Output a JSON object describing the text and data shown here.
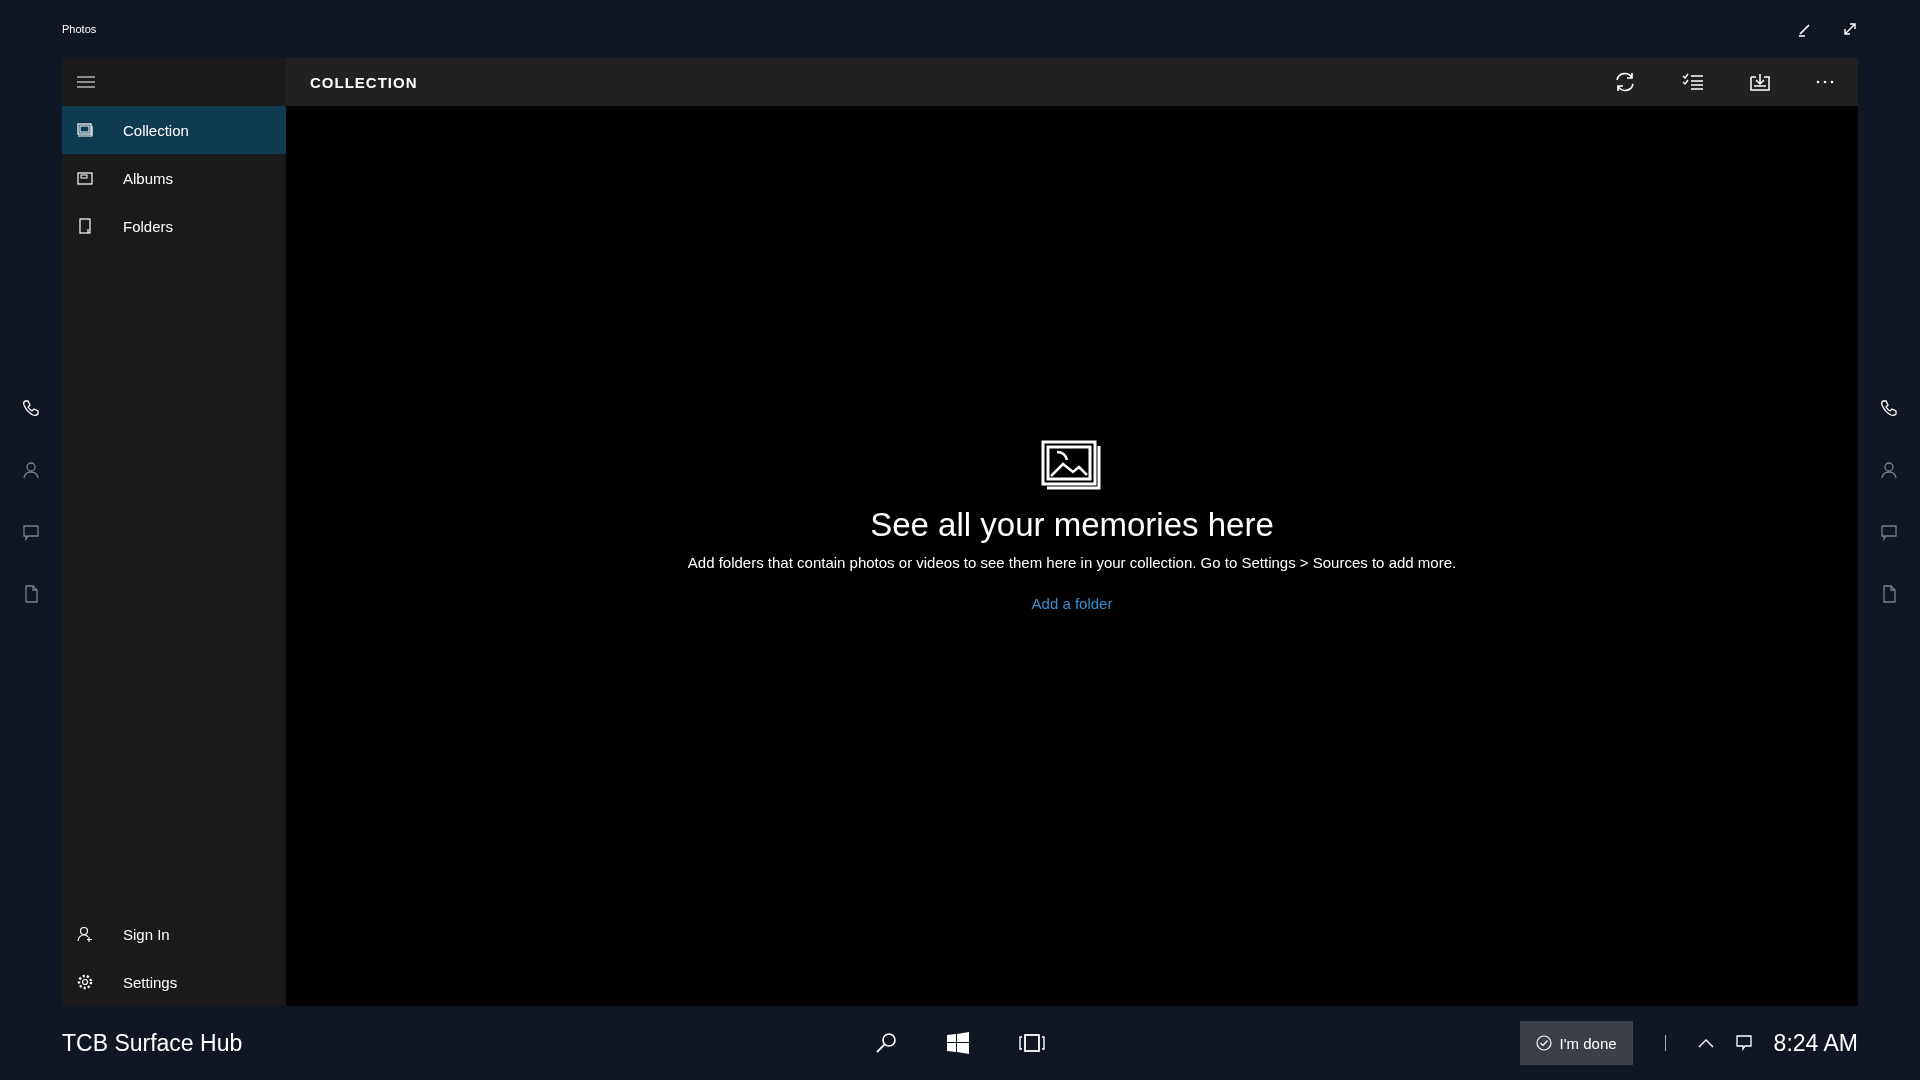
{
  "app_title": "Photos",
  "nav_items": [
    {
      "label": "Collection",
      "selected": true
    },
    {
      "label": "Albums",
      "selected": false
    },
    {
      "label": "Folders",
      "selected": false
    }
  ],
  "bottom_items": [
    {
      "label": "Sign In"
    },
    {
      "label": "Settings"
    }
  ],
  "header": {
    "title": "COLLECTION"
  },
  "empty_state": {
    "heading": "See all your memories here",
    "message": "Add folders that contain photos or videos to see them here in your collection. Go to Settings > Sources to add more.",
    "link": "Add a folder"
  },
  "taskbar": {
    "device_name": "TCB Surface Hub",
    "done_button": "I'm done",
    "clock": "8:24 AM"
  }
}
